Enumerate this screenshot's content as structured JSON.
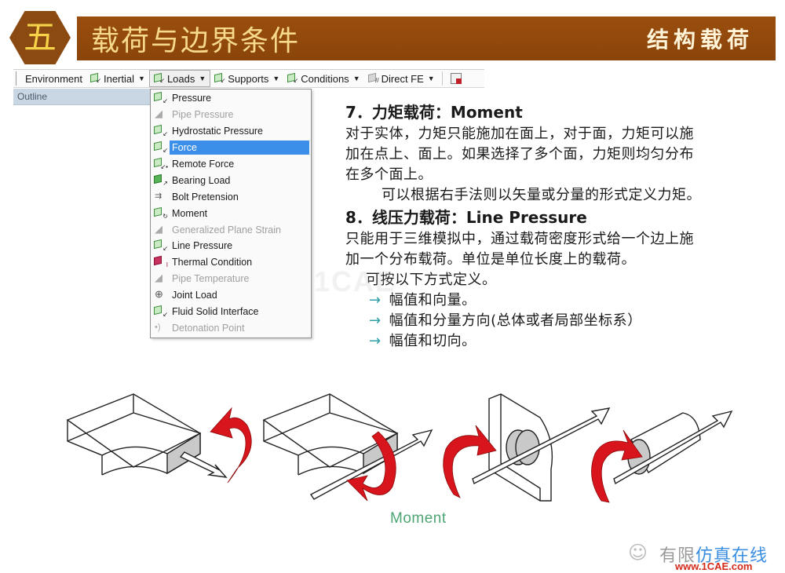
{
  "header": {
    "chapter_badge": "五",
    "title": "载荷与边界条件",
    "subtitle": "结构载荷",
    "colors": {
      "bar": "#8e470c",
      "badge_text": "#f7d34a",
      "title_text": "#f6d98a"
    }
  },
  "toolbar": {
    "items": [
      {
        "label": "Environment",
        "icon": "none",
        "has_dropdown": false
      },
      {
        "label": "Inertial",
        "icon": "cube-icon",
        "has_dropdown": true
      },
      {
        "label": "Loads",
        "icon": "cube-icon",
        "has_dropdown": true,
        "pressed": true
      },
      {
        "label": "Supports",
        "icon": "cube-icon",
        "has_dropdown": true
      },
      {
        "label": "Conditions",
        "icon": "cube-icon",
        "has_dropdown": true
      },
      {
        "label": "Direct FE",
        "icon": "direct-fe-icon",
        "has_dropdown": true
      }
    ],
    "end_icon": "worksheet-icon"
  },
  "outline": {
    "label": "Outline"
  },
  "loads_menu": {
    "selected": "Force",
    "items": [
      {
        "label": "Pressure",
        "enabled": true,
        "icon": "pressure-icon"
      },
      {
        "label": "Pipe Pressure",
        "enabled": false,
        "icon": "pipe-pressure-icon"
      },
      {
        "label": "Hydrostatic Pressure",
        "enabled": true,
        "icon": "hydrostatic-pressure-icon"
      },
      {
        "label": "Force",
        "enabled": true,
        "icon": "force-icon"
      },
      {
        "label": "Remote Force",
        "enabled": true,
        "icon": "remote-force-icon"
      },
      {
        "label": "Bearing Load",
        "enabled": true,
        "icon": "bearing-load-icon"
      },
      {
        "label": "Bolt Pretension",
        "enabled": true,
        "icon": "bolt-pretension-icon"
      },
      {
        "label": "Moment",
        "enabled": true,
        "icon": "moment-icon"
      },
      {
        "label": "Generalized Plane Strain",
        "enabled": false,
        "icon": "plane-strain-icon"
      },
      {
        "label": "Line Pressure",
        "enabled": true,
        "icon": "line-pressure-icon"
      },
      {
        "label": "Thermal Condition",
        "enabled": true,
        "icon": "thermal-condition-icon"
      },
      {
        "label": "Pipe Temperature",
        "enabled": false,
        "icon": "pipe-temperature-icon"
      },
      {
        "label": "Joint Load",
        "enabled": true,
        "icon": "joint-load-icon"
      },
      {
        "label": "Fluid Solid Interface",
        "enabled": true,
        "icon": "fluid-solid-interface-icon"
      },
      {
        "label": "Detonation Point",
        "enabled": false,
        "icon": "detonation-point-icon"
      }
    ]
  },
  "content": {
    "section7": {
      "heading": "7．力矩载荷：Moment",
      "lines": [
        "对于实体，力矩只能施加在面上，对于面，力矩可以施",
        "加在点上、面上。如果选择了多个面，力矩则均匀分布",
        "在多个面上。"
      ],
      "note": "可以根据右手法则以矢量或分量的形式定义力矩。"
    },
    "section8": {
      "heading": "8．线压力载荷：Line   Pressure",
      "lines": [
        "只能用于三维模拟中，通过载荷密度形式给一个边上施",
        "加一个分布载荷。单位是单位长度上的载荷。"
      ],
      "intro": "可按以下方式定义。",
      "bullets": [
        "幅值和向量。",
        "幅值和分量方向(总体或者局部坐标系）",
        "幅值和切向。"
      ],
      "bullet_icon": "arrow-right-icon",
      "bullet_color": "#2fa0a8"
    }
  },
  "watermark": "1CAE",
  "figure": {
    "caption": "Moment",
    "caption_color": "#4ea574",
    "arrow_color": "#d8141c"
  },
  "footer": {
    "logo_text_gray": "有限",
    "logo_text_blue": "仿真在线",
    "url": "www.1CAE.com"
  }
}
